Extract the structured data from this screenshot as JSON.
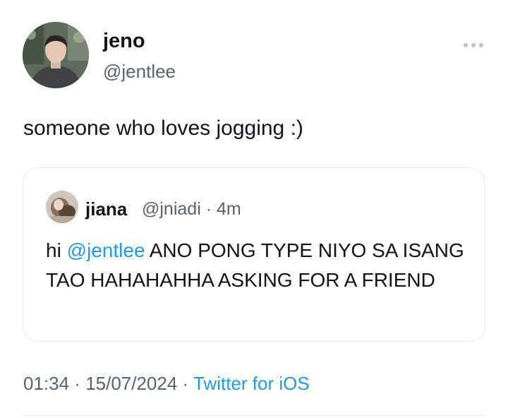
{
  "author": {
    "name": "jeno",
    "handle": "@jentlee"
  },
  "tweet": {
    "text": "someone who loves jogging :)"
  },
  "quoted_tweet": {
    "name": "jiana",
    "handle": "@jniadi",
    "time": "4m",
    "text_before": "hi ",
    "mention": "@jentlee",
    "text_after": " ANO PONG TYPE NIYO SA ISANG TAO HAHAHAHHA ASKING FOR A FRIEND"
  },
  "footer": {
    "time": "01:34",
    "date": "15/07/2024",
    "source": "Twitter for iOS"
  },
  "colors": {
    "link": "#1d9bf0",
    "secondary_text": "#536471",
    "border": "#e4e9ed"
  },
  "icons": {
    "more": "more-horizontal-icon"
  }
}
